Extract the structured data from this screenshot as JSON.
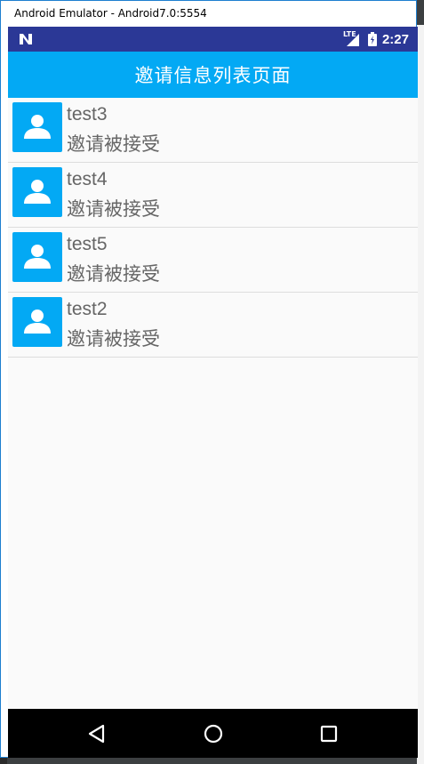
{
  "window": {
    "title": "Android Emulator - Android7.0:5554"
  },
  "statusbar": {
    "network_label": "LTE",
    "time": "2:27"
  },
  "appbar": {
    "title": "邀请信息列表页面"
  },
  "invites": [
    {
      "name": "test3",
      "status": "邀请被接受"
    },
    {
      "name": "test4",
      "status": "邀请被接受"
    },
    {
      "name": "test5",
      "status": "邀请被接受"
    },
    {
      "name": "test2",
      "status": "邀请被接受"
    }
  ],
  "navbar": {
    "back_icon": "back-triangle-icon",
    "home_icon": "home-circle-icon",
    "recent_icon": "recent-square-icon"
  },
  "colors": {
    "accent": "#03a9f4",
    "statusbar": "#2b3896",
    "text": "#666666"
  }
}
